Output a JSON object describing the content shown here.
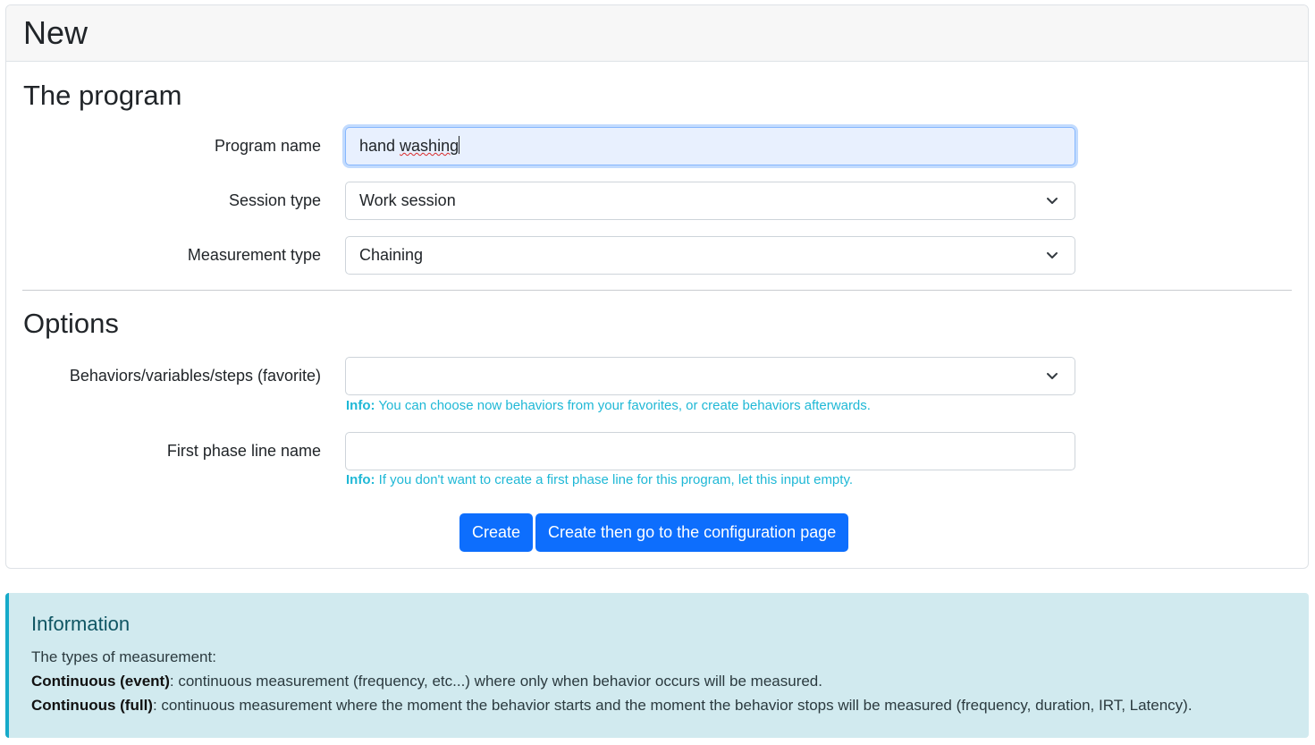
{
  "header": {
    "title": "New"
  },
  "program_section": {
    "title": "The program",
    "fields": {
      "program_name": {
        "label": "Program name",
        "value_plain": "hand ",
        "value_misspelled": "washing"
      },
      "session_type": {
        "label": "Session type",
        "selected": "Work session"
      },
      "measurement_type": {
        "label": "Measurement type",
        "selected": "Chaining"
      }
    }
  },
  "options_section": {
    "title": "Options",
    "behaviors": {
      "label": "Behaviors/variables/steps (favorite)",
      "selected": "",
      "info_prefix": "Info:",
      "info_text": " You can choose now behaviors from your favorites, or create behaviors afterwards."
    },
    "first_phase": {
      "label": "First phase line name",
      "value": "",
      "info_prefix": "Info:",
      "info_text": " If you don't want to create a first phase line for this program, let this input empty."
    }
  },
  "buttons": {
    "create": "Create",
    "create_config": "Create then go to the configuration page"
  },
  "information": {
    "title": "Information",
    "intro": "The types of measurement:",
    "items": [
      {
        "term": "Continuous (event)",
        "desc": ": continuous measurement (frequency, etc...) where only when behavior occurs will be measured."
      },
      {
        "term": "Continuous (full)",
        "desc": ": continuous measurement where the moment the behavior starts and the moment the behavior stops will be measured (frequency, duration, IRT, Latency)."
      }
    ]
  },
  "colors": {
    "primary": "#0d6efd",
    "info_text": "#1fb8d6",
    "alert_bg": "#d1eaef",
    "alert_border": "#16aac9"
  }
}
